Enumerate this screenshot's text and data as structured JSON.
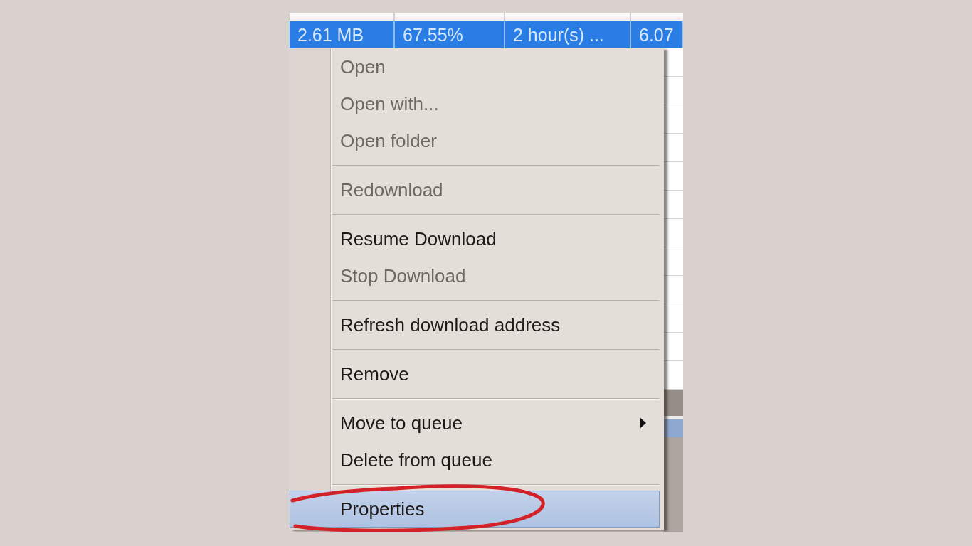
{
  "table": {
    "rows": [
      {
        "cells": [
          "2.61 MB",
          "67.55%",
          "2 hour(s) ...",
          "6.07"
        ],
        "selected": true
      }
    ]
  },
  "context_menu": {
    "items": [
      {
        "kind": "item",
        "label": "Open",
        "disabled": true,
        "selected": false,
        "submenu": false
      },
      {
        "kind": "item",
        "label": "Open with...",
        "disabled": true,
        "selected": false,
        "submenu": false
      },
      {
        "kind": "item",
        "label": "Open folder",
        "disabled": true,
        "selected": false,
        "submenu": false
      },
      {
        "kind": "separator"
      },
      {
        "kind": "item",
        "label": "Redownload",
        "disabled": true,
        "selected": false,
        "submenu": false
      },
      {
        "kind": "separator"
      },
      {
        "kind": "item",
        "label": "Resume Download",
        "disabled": false,
        "selected": false,
        "submenu": false
      },
      {
        "kind": "item",
        "label": "Stop Download",
        "disabled": true,
        "selected": false,
        "submenu": false
      },
      {
        "kind": "separator"
      },
      {
        "kind": "item",
        "label": "Refresh download address",
        "disabled": false,
        "selected": false,
        "submenu": false
      },
      {
        "kind": "separator"
      },
      {
        "kind": "item",
        "label": "Remove",
        "disabled": false,
        "selected": false,
        "submenu": false
      },
      {
        "kind": "separator"
      },
      {
        "kind": "item",
        "label": "Move to queue",
        "disabled": false,
        "selected": false,
        "submenu": true
      },
      {
        "kind": "item",
        "label": "Delete from queue",
        "disabled": false,
        "selected": false,
        "submenu": false
      },
      {
        "kind": "separator"
      },
      {
        "kind": "item",
        "label": "Properties",
        "disabled": false,
        "selected": true,
        "submenu": false
      }
    ]
  }
}
